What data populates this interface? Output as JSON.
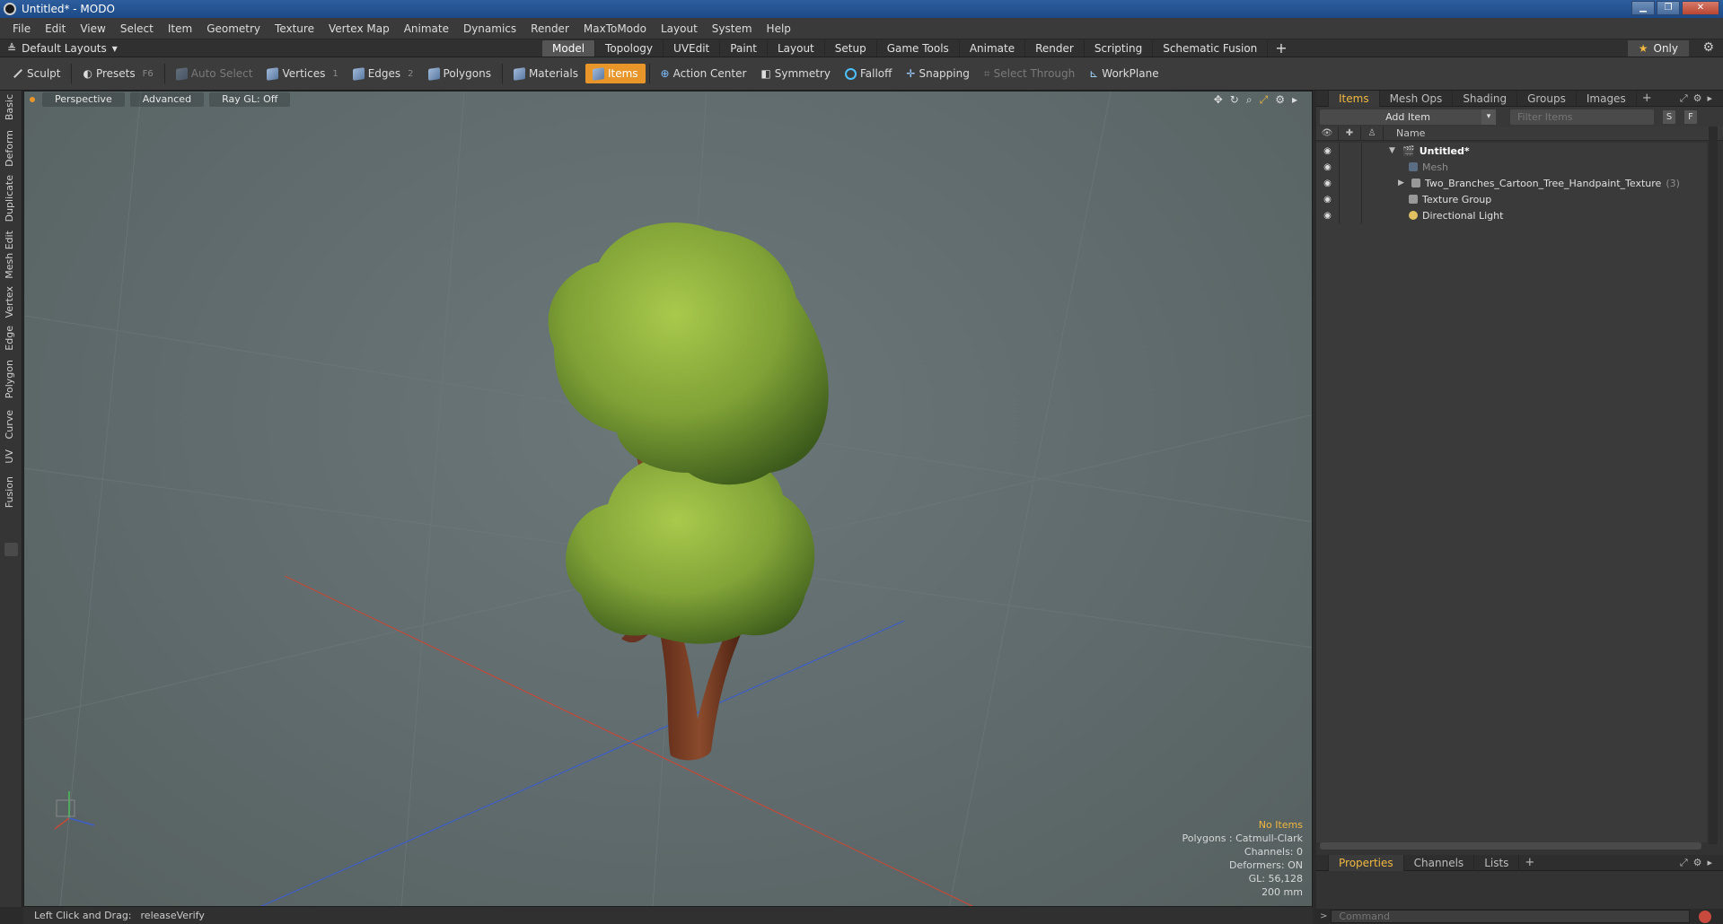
{
  "window": {
    "title": "Untitled* - MODO"
  },
  "menu": [
    "File",
    "Edit",
    "View",
    "Select",
    "Item",
    "Geometry",
    "Texture",
    "Vertex Map",
    "Animate",
    "Dynamics",
    "Render",
    "MaxToModo",
    "Layout",
    "System",
    "Help"
  ],
  "layoutbar": {
    "layout_selector": "Default Layouts",
    "tabs": [
      "Model",
      "Topology",
      "UVEdit",
      "Paint",
      "Layout",
      "Setup",
      "Game Tools",
      "Animate",
      "Render",
      "Scripting",
      "Schematic Fusion"
    ],
    "active_tab": "Model",
    "only_label": "Only"
  },
  "toolbar": {
    "sculpt": "Sculpt",
    "presets": "Presets",
    "presets_key": "F6",
    "auto_select": "Auto Select",
    "vertices": "Vertices",
    "vertices_key": "1",
    "edges": "Edges",
    "edges_key": "2",
    "polygons": "Polygons",
    "materials": "Materials",
    "items": "Items",
    "action_center": "Action Center",
    "symmetry": "Symmetry",
    "falloff": "Falloff",
    "snapping": "Snapping",
    "select_through": "Select Through",
    "workplane": "WorkPlane"
  },
  "left_tabs": [
    "Basic",
    "Deform",
    "Duplicate",
    "Mesh Edit",
    "Vertex",
    "Edge",
    "Polygon",
    "Curve",
    "UV",
    "Fusion"
  ],
  "viewport": {
    "view_mode": "Perspective",
    "advanced": "Advanced",
    "raygl": "Ray GL: Off",
    "stats": {
      "no_items": "No Items",
      "polygons": "Polygons : Catmull-Clark",
      "channels": "Channels: 0",
      "deformers": "Deformers: ON",
      "gl": "GL: 56,128",
      "scale": "200 mm"
    },
    "colors": {
      "leaf_light": "#a8c84a",
      "leaf_dark": "#3f5e1c",
      "trunk": "#7a3a22",
      "axis_x": "#c44a3a",
      "axis_z": "#3c5ec8"
    }
  },
  "status": {
    "hint": "Left Click and Drag:",
    "action": "releaseVerify"
  },
  "items_panel": {
    "tabs": [
      "Items",
      "Mesh Ops",
      "Shading",
      "Groups",
      "Images"
    ],
    "active_tab": "Items",
    "add_item": "Add Item",
    "filter_placeholder": "Filter Items",
    "s_button": "S",
    "f_button": "F",
    "column_name": "Name",
    "tree": [
      {
        "label": "Untitled*"
      },
      {
        "label": "Mesh"
      },
      {
        "label": "Two_Branches_Cartoon_Tree_Handpaint_Texture",
        "count": "(3)"
      },
      {
        "label": "Texture Group"
      },
      {
        "label": "Directional Light"
      }
    ]
  },
  "props_panel": {
    "tabs": [
      "Properties",
      "Channels",
      "Lists"
    ],
    "active_tab": "Properties"
  },
  "command": {
    "placeholder": "Command"
  }
}
